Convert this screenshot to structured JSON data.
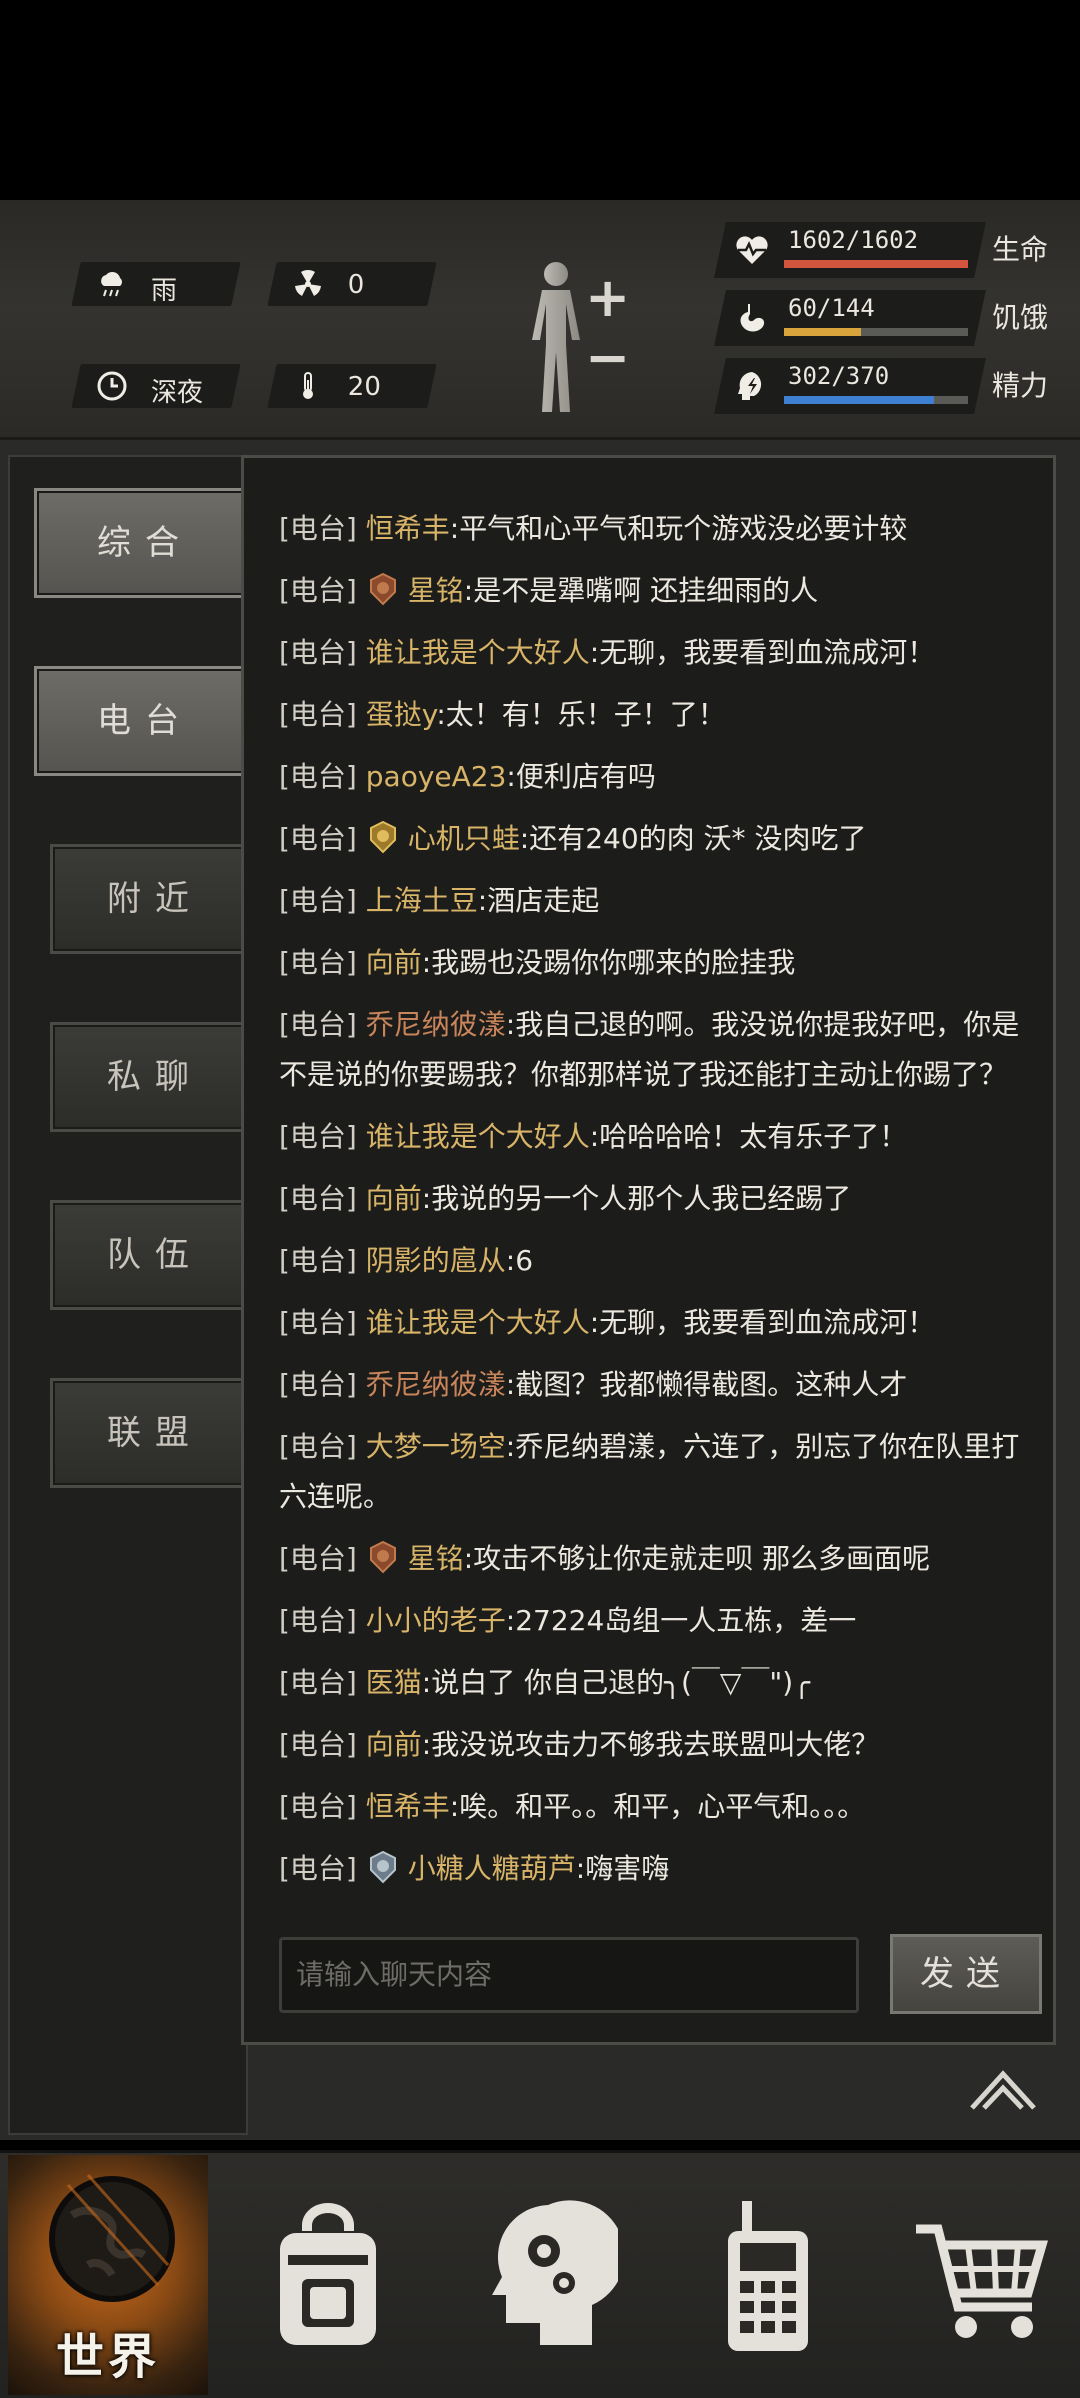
{
  "status": {
    "weather": "雨",
    "radiation": "0",
    "time_of_day": "深夜",
    "temperature": "20"
  },
  "vitals": [
    {
      "value": "1602/1602",
      "label": "生命",
      "fraction": 1.0,
      "color": "#d4553d",
      "icon": "heartbeat-icon"
    },
    {
      "value": "60/144",
      "label": "饥饿",
      "fraction": 0.4167,
      "color": "#d9a43c",
      "icon": "stomach-icon"
    },
    {
      "value": "302/370",
      "label": "精力",
      "fraction": 0.8162,
      "color": "#3f7fd1",
      "icon": "brain-icon"
    }
  ],
  "tabs": [
    "综合",
    "电台",
    "附近",
    "私聊",
    "队伍",
    "联盟"
  ],
  "active_tab": "电台",
  "messages": [
    {
      "channel": "[电台]",
      "user": "恒希丰",
      "text": ":平气和心平气和玩个游戏没必要计较",
      "color": "gold",
      "badge": ""
    },
    {
      "channel": "[电台]",
      "user": "星铭",
      "text": ":是不是犟嘴啊 还挂细雨的人",
      "color": "gold",
      "badge": "bronze"
    },
    {
      "channel": "[电台]",
      "user": "谁让我是个大好人",
      "text": ":无聊，我要看到血流成河！",
      "color": "gold",
      "badge": ""
    },
    {
      "channel": "[电台]",
      "user": "蛋挞y",
      "text": ":太！有！乐！子！了！",
      "color": "gold",
      "badge": ""
    },
    {
      "channel": "[电台]",
      "user": "paoyeA23",
      "text": ":便利店有吗",
      "color": "gold",
      "badge": ""
    },
    {
      "channel": "[电台]",
      "user": "心机只蛙",
      "text": ":还有240的肉 沃* 没肉吃了",
      "color": "gold",
      "badge": "gold"
    },
    {
      "channel": "[电台]",
      "user": "上海土豆",
      "text": ":酒店走起",
      "color": "gold",
      "badge": ""
    },
    {
      "channel": "[电台]",
      "user": "向前",
      "text": ":我踢也没踢你你哪来的脸挂我",
      "color": "gold",
      "badge": ""
    },
    {
      "channel": "[电台]",
      "user": "乔尼纳彼漾",
      "text": ":我自己退的啊。我没说你提我好吧，你是不是说的你要踢我？你都那样说了我还能打主动让你踢了？",
      "color": "orange",
      "badge": "",
      "wrap": true
    },
    {
      "channel": "[电台]",
      "user": "谁让我是个大好人",
      "text": ":哈哈哈哈！太有乐子了！",
      "color": "gold",
      "badge": ""
    },
    {
      "channel": "[电台]",
      "user": "向前",
      "text": ":我说的另一个人那个人我已经踢了",
      "color": "gold",
      "badge": ""
    },
    {
      "channel": "[电台]",
      "user": "阴影的扈从",
      "text": ":6",
      "color": "gold",
      "badge": ""
    },
    {
      "channel": "[电台]",
      "user": "谁让我是个大好人",
      "text": ":无聊，我要看到血流成河！",
      "color": "gold",
      "badge": ""
    },
    {
      "channel": "[电台]",
      "user": "乔尼纳彼漾",
      "text": ":截图？我都懒得截图。这种人才",
      "color": "orange",
      "badge": ""
    },
    {
      "channel": "[电台]",
      "user": "大梦一场空",
      "text": ":乔尼纳碧漾，六连了，别忘了你在队里打六连呢。",
      "color": "gold",
      "badge": "",
      "wrap": true
    },
    {
      "channel": "[电台]",
      "user": "星铭",
      "text": ":攻击不够让你走就走呗 那么多画面呢",
      "color": "gold",
      "badge": "bronze"
    },
    {
      "channel": "[电台]",
      "user": "小小的老子",
      "text": ":27224岛组一人五栋，差一",
      "color": "gold",
      "badge": ""
    },
    {
      "channel": "[电台]",
      "user": "医猫",
      "text": ":说白了 你自己退的╮(￣▽￣\")╭",
      "color": "gold",
      "badge": ""
    },
    {
      "channel": "[电台]",
      "user": "向前",
      "text": ":我没说攻击力不够我去联盟叫大佬？",
      "color": "gold",
      "badge": ""
    },
    {
      "channel": "[电台]",
      "user": "恒希丰",
      "text": ":唉。和平。。和平，心平气和。。。",
      "color": "gold",
      "badge": ""
    },
    {
      "channel": "[电台]",
      "user": "小糖人糖葫芦",
      "text": ":嗨害嗨",
      "color": "gold",
      "badge": "silver"
    }
  ],
  "input": {
    "placeholder": "请输入聊天内容"
  },
  "send_label": "发送",
  "bottom_nav": {
    "world_label": "世界",
    "items": [
      "backpack-icon",
      "skills-head-icon",
      "radio-phone-icon",
      "shop-cart-icon"
    ]
  }
}
